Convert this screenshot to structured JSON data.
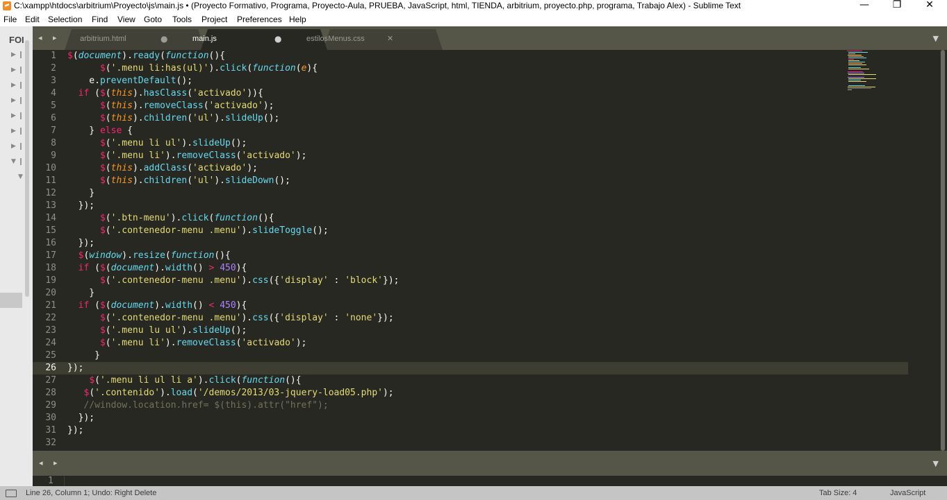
{
  "window": {
    "title": "C:\\xampp\\htdocs\\arbitrium\\Proyecto\\js\\main.js • (Proyecto Formativo, Programa, Proyecto-Aula, PRUEBA, JavaScript, html, TIENDA, arbitrium, proyecto.php, programa, Trabajo Alex) - Sublime Text",
    "controls": {
      "minimize": "—",
      "maximize": "❐",
      "close": "✕"
    }
  },
  "menu": [
    "File",
    "Edit",
    "Selection",
    "Find",
    "View",
    "Goto",
    "Tools",
    "Project",
    "Preferences",
    "Help"
  ],
  "sidebar": {
    "header": "FOI"
  },
  "tabs": {
    "nav": "◂ ▸",
    "overflow": "▼",
    "items": [
      {
        "label": "arbitrium.html",
        "mark": "●",
        "active": false
      },
      {
        "label": "main.js",
        "mark": "●",
        "active": true
      },
      {
        "label": "estilosMenus.css",
        "mark": "✕",
        "active": false
      }
    ]
  },
  "editor": {
    "active_line": 26,
    "line_numbers": [
      "1",
      "2",
      "3",
      "4",
      "5",
      "6",
      "7",
      "8",
      "9",
      "10",
      "11",
      "12",
      "13",
      "14",
      "15",
      "16",
      "17",
      "18",
      "19",
      "20",
      "21",
      "22",
      "23",
      "24",
      "25",
      "26",
      "27",
      "28",
      "29",
      "30",
      "31",
      "32"
    ],
    "lines": [
      [
        [
          "y",
          "$"
        ],
        [
          "w",
          "("
        ],
        [
          "i",
          "document"
        ],
        [
          "w",
          ")."
        ],
        [
          "f",
          "ready"
        ],
        [
          "w",
          "("
        ],
        [
          "i",
          "function"
        ],
        [
          "w",
          "(){"
        ]
      ],
      [
        [
          "w",
          "      "
        ],
        [
          "y",
          "$"
        ],
        [
          "w",
          "("
        ],
        [
          "s",
          "'.menu li:has(ul)'"
        ],
        [
          "w",
          ")."
        ],
        [
          "f",
          "click"
        ],
        [
          "w",
          "("
        ],
        [
          "i",
          "function"
        ],
        [
          "w",
          "("
        ],
        [
          "o",
          "e"
        ],
        [
          "w",
          "){"
        ]
      ],
      [
        [
          "w",
          "    e."
        ],
        [
          "f",
          "preventDefault"
        ],
        [
          "w",
          "();"
        ]
      ],
      [
        [
          "w",
          "  "
        ],
        [
          "k",
          "if"
        ],
        [
          "w",
          " ("
        ],
        [
          "y",
          "$"
        ],
        [
          "w",
          "("
        ],
        [
          "o",
          "this"
        ],
        [
          "w",
          ")."
        ],
        [
          "f",
          "hasClass"
        ],
        [
          "w",
          "("
        ],
        [
          "s",
          "'activado'"
        ],
        [
          "w",
          "))"
        ],
        [
          "w",
          "{"
        ]
      ],
      [
        [
          "w",
          "      "
        ],
        [
          "y",
          "$"
        ],
        [
          "w",
          "("
        ],
        [
          "o",
          "this"
        ],
        [
          "w",
          ")."
        ],
        [
          "f",
          "removeClass"
        ],
        [
          "w",
          "("
        ],
        [
          "s",
          "'activado'"
        ],
        [
          "w",
          ");"
        ]
      ],
      [
        [
          "w",
          "      "
        ],
        [
          "y",
          "$"
        ],
        [
          "w",
          "("
        ],
        [
          "o",
          "this"
        ],
        [
          "w",
          ")."
        ],
        [
          "f",
          "children"
        ],
        [
          "w",
          "("
        ],
        [
          "s",
          "'ul'"
        ],
        [
          "w",
          ")."
        ],
        [
          "f",
          "slideUp"
        ],
        [
          "w",
          "();"
        ]
      ],
      [
        [
          "w",
          "    } "
        ],
        [
          "k",
          "else"
        ],
        [
          "w",
          " {"
        ]
      ],
      [
        [
          "w",
          "      "
        ],
        [
          "y",
          "$"
        ],
        [
          "w",
          "("
        ],
        [
          "s",
          "'.menu li ul'"
        ],
        [
          "w",
          ")."
        ],
        [
          "f",
          "slideUp"
        ],
        [
          "w",
          "();"
        ]
      ],
      [
        [
          "w",
          "      "
        ],
        [
          "y",
          "$"
        ],
        [
          "w",
          "("
        ],
        [
          "s",
          "'.menu li'"
        ],
        [
          "w",
          ")."
        ],
        [
          "f",
          "removeClass"
        ],
        [
          "w",
          "("
        ],
        [
          "s",
          "'activado'"
        ],
        [
          "w",
          ");"
        ]
      ],
      [
        [
          "w",
          "      "
        ],
        [
          "y",
          "$"
        ],
        [
          "w",
          "("
        ],
        [
          "o",
          "this"
        ],
        [
          "w",
          ")."
        ],
        [
          "f",
          "addClass"
        ],
        [
          "w",
          "("
        ],
        [
          "s",
          "'activado'"
        ],
        [
          "w",
          ");"
        ]
      ],
      [
        [
          "w",
          "      "
        ],
        [
          "y",
          "$"
        ],
        [
          "w",
          "("
        ],
        [
          "o",
          "this"
        ],
        [
          "w",
          ")."
        ],
        [
          "f",
          "children"
        ],
        [
          "w",
          "("
        ],
        [
          "s",
          "'ul'"
        ],
        [
          "w",
          ")."
        ],
        [
          "f",
          "slideDown"
        ],
        [
          "w",
          "();"
        ]
      ],
      [
        [
          "w",
          "    }"
        ]
      ],
      [
        [
          "w",
          "  });"
        ]
      ],
      [
        [
          "w",
          "      "
        ],
        [
          "y",
          "$"
        ],
        [
          "w",
          "("
        ],
        [
          "s",
          "'.btn-menu'"
        ],
        [
          "w",
          ")."
        ],
        [
          "f",
          "click"
        ],
        [
          "w",
          "("
        ],
        [
          "i",
          "function"
        ],
        [
          "w",
          "(){"
        ]
      ],
      [
        [
          "w",
          "      "
        ],
        [
          "y",
          "$"
        ],
        [
          "w",
          "("
        ],
        [
          "s",
          "'.contenedor-menu .menu'"
        ],
        [
          "w",
          ")."
        ],
        [
          "f",
          "slideToggle"
        ],
        [
          "w",
          "();"
        ]
      ],
      [
        [
          "w",
          "  });"
        ]
      ],
      [
        [
          "w",
          "  "
        ],
        [
          "y",
          "$"
        ],
        [
          "w",
          "("
        ],
        [
          "i",
          "window"
        ],
        [
          "w",
          ")."
        ],
        [
          "f",
          "resize"
        ],
        [
          "w",
          "("
        ],
        [
          "i",
          "function"
        ],
        [
          "w",
          "(){"
        ]
      ],
      [
        [
          "w",
          "  "
        ],
        [
          "k",
          "if"
        ],
        [
          "w",
          " ("
        ],
        [
          "y",
          "$"
        ],
        [
          "w",
          "("
        ],
        [
          "i",
          "document"
        ],
        [
          "w",
          ")."
        ],
        [
          "f",
          "width"
        ],
        [
          "w",
          "() "
        ],
        [
          "k",
          ">"
        ],
        [
          "w",
          " "
        ],
        [
          "n",
          "450"
        ],
        [
          "w",
          "){"
        ]
      ],
      [
        [
          "w",
          "      "
        ],
        [
          "y",
          "$"
        ],
        [
          "w",
          "("
        ],
        [
          "s",
          "'.contenedor-menu .menu'"
        ],
        [
          "w",
          ")."
        ],
        [
          "f",
          "css"
        ],
        [
          "w",
          "({"
        ],
        [
          "s",
          "'display'"
        ],
        [
          "w",
          " : "
        ],
        [
          "s",
          "'block'"
        ],
        [
          "w",
          "});"
        ]
      ],
      [
        [
          "w",
          "    }"
        ]
      ],
      [
        [
          "w",
          "  "
        ],
        [
          "k",
          "if"
        ],
        [
          "w",
          " ("
        ],
        [
          "y",
          "$"
        ],
        [
          "w",
          "("
        ],
        [
          "i",
          "document"
        ],
        [
          "w",
          ")."
        ],
        [
          "f",
          "width"
        ],
        [
          "w",
          "() "
        ],
        [
          "k",
          "<"
        ],
        [
          "w",
          " "
        ],
        [
          "n",
          "450"
        ],
        [
          "w",
          "){"
        ]
      ],
      [
        [
          "w",
          "      "
        ],
        [
          "y",
          "$"
        ],
        [
          "w",
          "("
        ],
        [
          "s",
          "'.contenedor-menu .menu'"
        ],
        [
          "w",
          ")."
        ],
        [
          "f",
          "css"
        ],
        [
          "w",
          "({"
        ],
        [
          "s",
          "'display'"
        ],
        [
          "w",
          " : "
        ],
        [
          "s",
          "'none'"
        ],
        [
          "w",
          "});"
        ]
      ],
      [
        [
          "w",
          "      "
        ],
        [
          "y",
          "$"
        ],
        [
          "w",
          "("
        ],
        [
          "s",
          "'.menu lu ul'"
        ],
        [
          "w",
          ")."
        ],
        [
          "f",
          "slideUp"
        ],
        [
          "w",
          "();"
        ]
      ],
      [
        [
          "w",
          "      "
        ],
        [
          "y",
          "$"
        ],
        [
          "w",
          "("
        ],
        [
          "s",
          "'.menu li'"
        ],
        [
          "w",
          ")."
        ],
        [
          "f",
          "removeClass"
        ],
        [
          "w",
          "("
        ],
        [
          "s",
          "'activado'"
        ],
        [
          "w",
          ");"
        ]
      ],
      [
        [
          "w",
          "     }"
        ]
      ],
      [
        [
          "w",
          "});"
        ]
      ],
      [
        [
          "w",
          "    "
        ],
        [
          "y",
          "$"
        ],
        [
          "w",
          "("
        ],
        [
          "s",
          "'.menu li ul li a'"
        ],
        [
          "w",
          ")."
        ],
        [
          "f",
          "click"
        ],
        [
          "w",
          "("
        ],
        [
          "i",
          "function"
        ],
        [
          "w",
          "(){"
        ]
      ],
      [
        [
          "w",
          "   "
        ],
        [
          "y",
          "$"
        ],
        [
          "w",
          "("
        ],
        [
          "s",
          "'.contenido'"
        ],
        [
          "w",
          ")."
        ],
        [
          "f",
          "load"
        ],
        [
          "w",
          "("
        ],
        [
          "s",
          "'/demos/2013/03-jquery-load05.php'"
        ],
        [
          "w",
          ");"
        ]
      ],
      [
        [
          "w",
          "   "
        ],
        [
          "c",
          "//window.location.href= $(this).attr(\"href\");"
        ]
      ],
      [
        [
          "w",
          "  });"
        ]
      ],
      [
        [
          "w",
          "});"
        ]
      ],
      [
        [
          "w",
          ""
        ]
      ]
    ]
  },
  "panel": {
    "nav": "◂ ▸",
    "overflow": "▼",
    "line_number": "1"
  },
  "status": {
    "position": "Line 26, Column 1; Undo: Right Delete",
    "tab_size": "Tab Size: 4",
    "syntax": "JavaScript"
  },
  "colors": {
    "editor_bg": "#272822",
    "keyword": "#f92672",
    "function": "#66d9ef",
    "string": "#e6db74",
    "param": "#fd971f",
    "number": "#ae81ff",
    "comment": "#75715e"
  }
}
